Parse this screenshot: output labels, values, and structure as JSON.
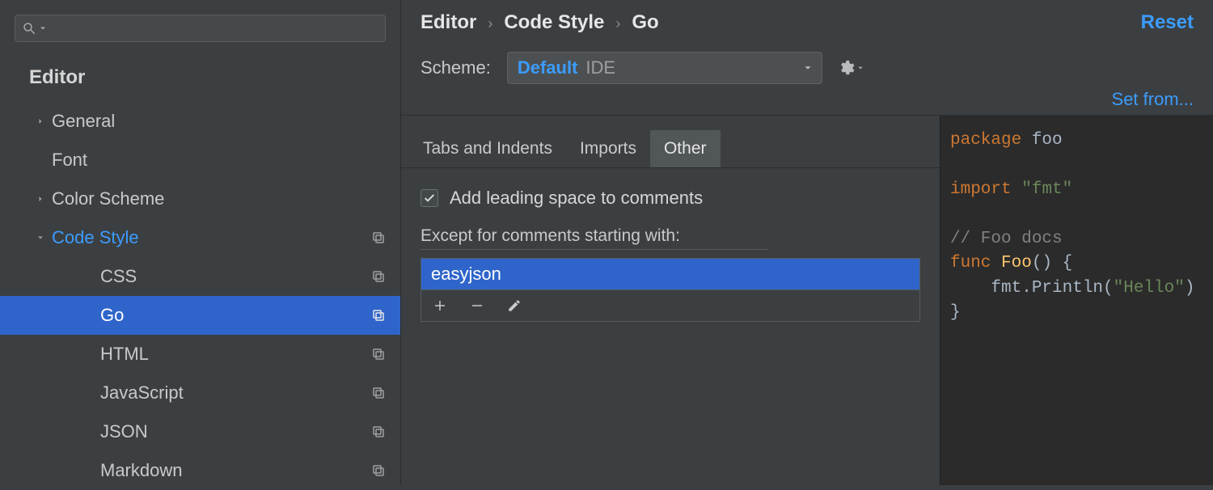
{
  "sidebar": {
    "header": "Editor",
    "items": [
      {
        "label": "General",
        "arrow": "right",
        "depth": 1,
        "copy": false
      },
      {
        "label": "Font",
        "arrow": null,
        "depth": 1,
        "copy": false
      },
      {
        "label": "Color Scheme",
        "arrow": "right",
        "depth": 1,
        "copy": false
      },
      {
        "label": "Code Style",
        "arrow": "down",
        "depth": 1,
        "copy": true,
        "highlight": "codestyle"
      },
      {
        "label": "CSS",
        "arrow": null,
        "depth": 2,
        "copy": true
      },
      {
        "label": "Go",
        "arrow": null,
        "depth": 2,
        "copy": true,
        "selected": true
      },
      {
        "label": "HTML",
        "arrow": null,
        "depth": 2,
        "copy": true
      },
      {
        "label": "JavaScript",
        "arrow": null,
        "depth": 2,
        "copy": true
      },
      {
        "label": "JSON",
        "arrow": null,
        "depth": 2,
        "copy": true
      },
      {
        "label": "Markdown",
        "arrow": null,
        "depth": 2,
        "copy": true
      }
    ]
  },
  "breadcrumb": [
    "Editor",
    "Code Style",
    "Go"
  ],
  "reset": "Reset",
  "scheme": {
    "label": "Scheme:",
    "value": "Default",
    "scope": "IDE"
  },
  "set_from": "Set from...",
  "tabs": [
    {
      "label": "Tabs and Indents",
      "active": false
    },
    {
      "label": "Imports",
      "active": false
    },
    {
      "label": "Other",
      "active": true
    }
  ],
  "option": {
    "checkbox_label": "Add leading space to comments",
    "checked": true,
    "except_label": "Except for comments starting with:",
    "items": [
      "easyjson"
    ]
  },
  "preview": {
    "lines": [
      {
        "t": "kw",
        "s": "package"
      },
      {
        "t": "",
        "s": " foo"
      },
      {
        "t": "br"
      },
      {
        "t": "br"
      },
      {
        "t": "kw",
        "s": "import"
      },
      {
        "t": "",
        "s": " "
      },
      {
        "t": "str",
        "s": "\"fmt\""
      },
      {
        "t": "br"
      },
      {
        "t": "br"
      },
      {
        "t": "cmt",
        "s": "// Foo docs"
      },
      {
        "t": "br"
      },
      {
        "t": "kw",
        "s": "func"
      },
      {
        "t": "",
        "s": " "
      },
      {
        "t": "fn",
        "s": "Foo"
      },
      {
        "t": "",
        "s": "() {"
      },
      {
        "t": "br"
      },
      {
        "t": "",
        "s": "    fmt.Println("
      },
      {
        "t": "str",
        "s": "\"Hello\""
      },
      {
        "t": "",
        "s": ")"
      },
      {
        "t": "br"
      },
      {
        "t": "",
        "s": "}"
      }
    ]
  }
}
